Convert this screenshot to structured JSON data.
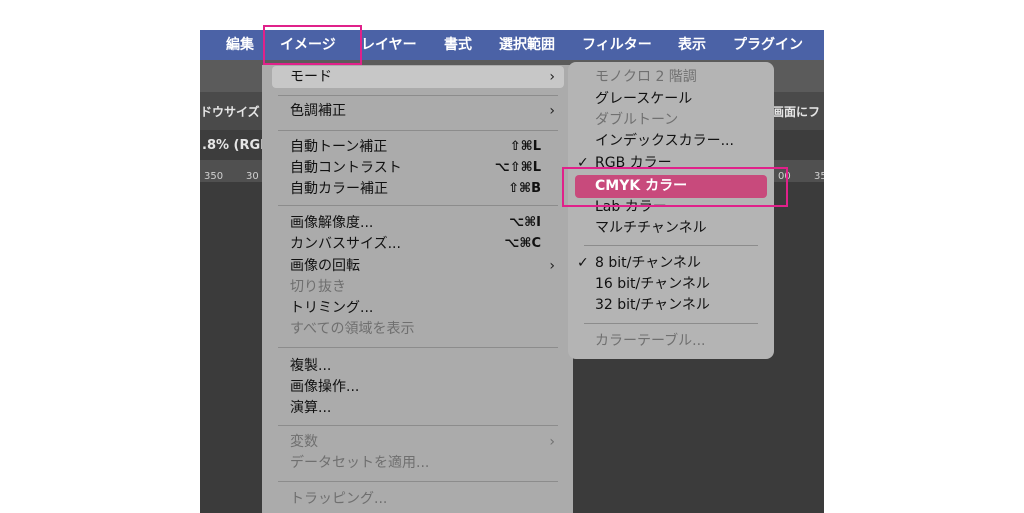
{
  "menubar": {
    "items": [
      "編集",
      "イメージ",
      "レイヤー",
      "書式",
      "選択範囲",
      "フィルター",
      "表示",
      "プラグイン"
    ]
  },
  "chrome": {
    "doc_size_label": "ドウサイズ",
    "right_option_label": "画面にフ",
    "doc_tab_label": ".8% (RGB",
    "ruler": [
      "350",
      "30",
      "00",
      "35"
    ]
  },
  "image_menu": {
    "mode": "モード",
    "color_adjust": "色調補正",
    "auto_tone": {
      "label": "自動トーン補正",
      "shortcut": "⇧⌘L"
    },
    "auto_contrast": {
      "label": "自動コントラスト",
      "shortcut": "⌥⇧⌘L"
    },
    "auto_color": {
      "label": "自動カラー補正",
      "shortcut": "⇧⌘B"
    },
    "image_size": {
      "label": "画像解像度...",
      "shortcut": "⌥⌘I"
    },
    "canvas_size": {
      "label": "カンバスサイズ...",
      "shortcut": "⌥⌘C"
    },
    "rotation": "画像の回転",
    "crop": "切り抜き",
    "trim": "トリミング...",
    "reveal_all": "すべての領域を表示",
    "duplicate": "複製...",
    "apply_image": "画像操作...",
    "calculations": "演算...",
    "variables": "変数",
    "apply_dataset": "データセットを適用...",
    "trap": "トラッピング..."
  },
  "mode_submenu": {
    "bitmap": "モノクロ 2 階調",
    "grayscale": "グレースケール",
    "duotone": "ダブルトーン",
    "indexed": "インデックスカラー...",
    "rgb": "RGB カラー",
    "cmyk": "CMYK カラー",
    "lab": "Lab カラー",
    "multichannel": "マルチチャンネル",
    "bit8": "8 bit/チャンネル",
    "bit16": "16 bit/チャンネル",
    "bit32": "32 bit/チャンネル",
    "color_table": "カラーテーブル...",
    "check": "✓",
    "arrow": "›"
  },
  "colors": {
    "menubar_bg": "#4b62a6",
    "menu_bg": "#ababab",
    "submenu_bg": "#b4b4b4",
    "selected_item": "#c84a7c",
    "callout": "#e0218a"
  }
}
